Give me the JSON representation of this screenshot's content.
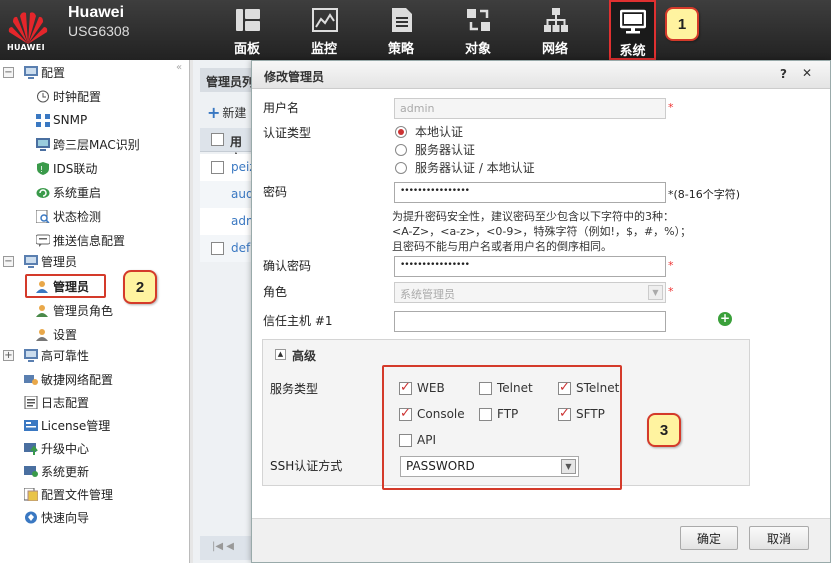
{
  "header": {
    "brand": "Huawei",
    "model": "USG6308",
    "logo_text": "HUAWEI",
    "nav": [
      {
        "label": "面板",
        "icon": "dashboard-icon"
      },
      {
        "label": "监控",
        "icon": "monitor-chart-icon"
      },
      {
        "label": "策略",
        "icon": "policy-document-icon"
      },
      {
        "label": "对象",
        "icon": "object-icon"
      },
      {
        "label": "网络",
        "icon": "network-icon"
      },
      {
        "label": "系统",
        "icon": "system-monitor-icon",
        "active": true
      }
    ]
  },
  "callouts": [
    "1",
    "2",
    "3"
  ],
  "sidebar": {
    "items": [
      {
        "label": "配置",
        "icon": "config-icon",
        "expand": "−"
      },
      {
        "label": "时钟配置",
        "icon": "clock-icon"
      },
      {
        "label": "SNMP",
        "icon": "snmp-icon"
      },
      {
        "label": "跨三层MAC识别",
        "icon": "mac-icon"
      },
      {
        "label": "IDS联动",
        "icon": "ids-icon"
      },
      {
        "label": "系统重启",
        "icon": "restart-icon"
      },
      {
        "label": "状态检测",
        "icon": "status-check-icon"
      },
      {
        "label": "推送信息配置",
        "icon": "push-message-icon"
      },
      {
        "label": "管理员",
        "icon": "admin-group-icon",
        "expand": "−"
      },
      {
        "label": "管理员",
        "icon": "admin-user-icon"
      },
      {
        "label": "管理员角色",
        "icon": "admin-role-icon"
      },
      {
        "label": "设置",
        "icon": "settings-icon"
      },
      {
        "label": "高可靠性",
        "icon": "ha-icon",
        "expand": "+"
      },
      {
        "label": "敏捷网络配置",
        "icon": "agile-network-icon"
      },
      {
        "label": "日志配置",
        "icon": "log-icon"
      },
      {
        "label": "License管理",
        "icon": "license-icon"
      },
      {
        "label": "升级中心",
        "icon": "upgrade-icon"
      },
      {
        "label": "系统更新",
        "icon": "update-icon"
      },
      {
        "label": "配置文件管理",
        "icon": "config-file-icon"
      },
      {
        "label": "快速向导",
        "icon": "wizard-icon"
      }
    ]
  },
  "background_panel": {
    "title": "管理员列",
    "new_button": "新建",
    "column_header": "用户",
    "rows": [
      "peiz",
      "aud",
      "adm",
      "defa"
    ],
    "pager": "|◀ ◀"
  },
  "dialog": {
    "title": "修改管理员",
    "help": "?",
    "close": "✕",
    "username_label": "用户名",
    "username_value": "admin",
    "auth_label": "认证类型",
    "auth_options": [
      "本地认证",
      "服务器认证",
      "服务器认证 / 本地认证"
    ],
    "password_label": "密码",
    "password_value": "••••••••••••••••",
    "password_rule": "*(8-16个字符)",
    "hint_lines": [
      "为提升密码安全性，建议密码至少包含以下字符中的3种：",
      "<A-Z>，<a-z>，<0-9>，特殊字符（例如!，$，#，%）；",
      "且密码不能与用户名或者用户名的倒序相同。"
    ],
    "confirm_label": "确认密码",
    "confirm_value": "••••••••••••••••",
    "role_label": "角色",
    "role_value": "系统管理员",
    "trust_label": "信任主机 #1",
    "required_mark": "*",
    "advanced_title": "高级",
    "service_label": "服务类型",
    "services": [
      {
        "label": "WEB",
        "checked": true
      },
      {
        "label": "Telnet",
        "checked": false
      },
      {
        "label": "STelnet",
        "checked": true
      },
      {
        "label": "Console",
        "checked": true
      },
      {
        "label": "FTP",
        "checked": false
      },
      {
        "label": "SFTP",
        "checked": true
      },
      {
        "label": "API",
        "checked": false
      }
    ],
    "ssh_label": "SSH认证方式",
    "ssh_value": "PASSWORD",
    "ok_button": "确定",
    "cancel_button": "取消"
  },
  "colors": {
    "highlight_red": "#d43a2a",
    "callout_fill": "#fff3a0",
    "check_red": "#cc3333",
    "add_green": "#3aa03a"
  }
}
